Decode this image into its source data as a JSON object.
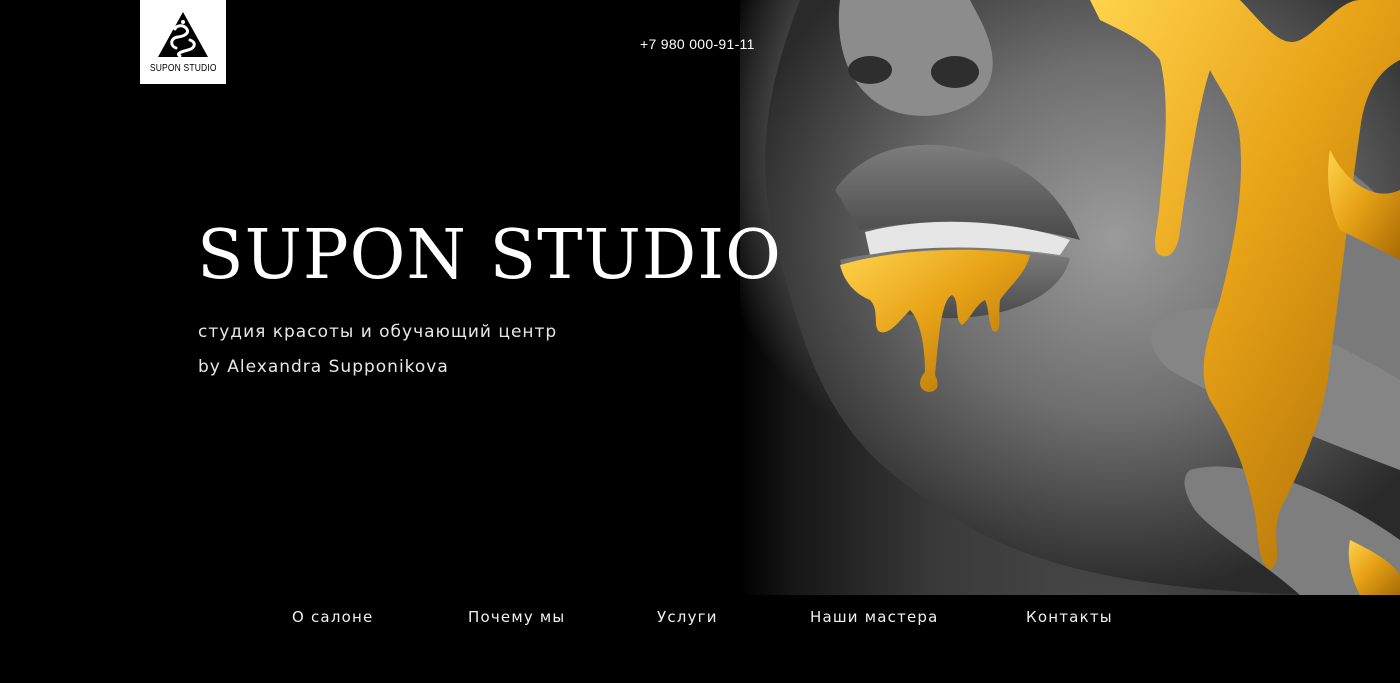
{
  "header": {
    "logo_text": "SUPON STUDIO",
    "phone": "+7 980 000-91-11"
  },
  "hero": {
    "title": "SUPON STUDIO",
    "subtitle_line1": "студия красоты и обучающий центр",
    "subtitle_line2": "by Alexandra Supponikova",
    "photo": "woman-face-gold-paint-image"
  },
  "nav": {
    "items": [
      {
        "label": "О салоне"
      },
      {
        "label": "Почему мы"
      },
      {
        "label": "Услуги"
      },
      {
        "label": "Наши мастера"
      },
      {
        "label": "Контакты"
      }
    ]
  },
  "colors": {
    "background": "#000000",
    "text": "#ffffff",
    "gold": "#e8a317"
  }
}
